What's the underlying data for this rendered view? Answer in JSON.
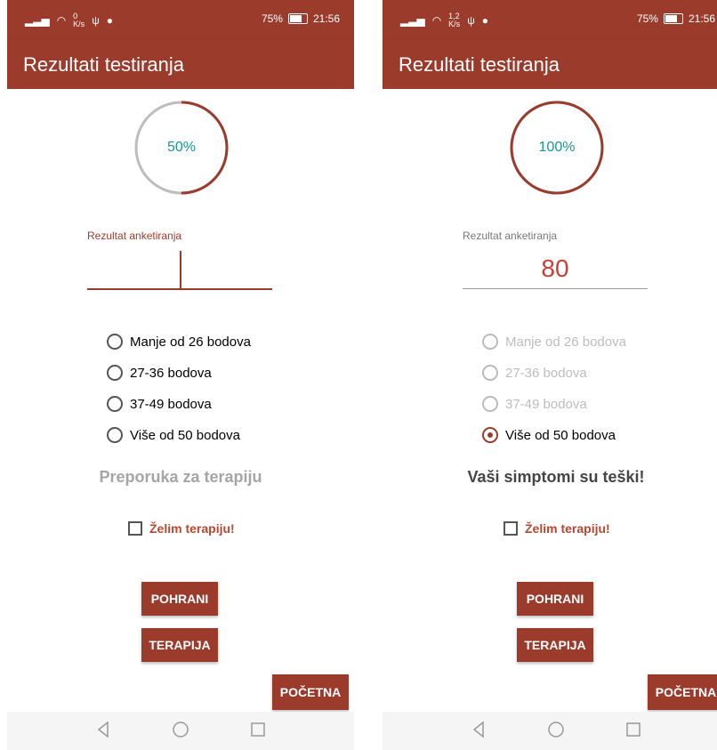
{
  "colors": {
    "accent": "#9b3b2c",
    "teal": "#139a8f",
    "light_grey": "#bdbdbd",
    "value_red": "#c73f36"
  },
  "screens": [
    {
      "status": {
        "speed_top": "0",
        "speed_unit": "K/s",
        "battery": "75%",
        "time": "21:56"
      },
      "appbar_title": "Rezultati testiranja",
      "progress_text": "50%",
      "progress_value": 0.5,
      "field_label": "Rezultat anketiranja",
      "field_value": "",
      "radio_options": [
        {
          "label": "Manje od 26 bodova",
          "checked": false,
          "disabled": false
        },
        {
          "label": "27-36 bodova",
          "checked": false,
          "disabled": false
        },
        {
          "label": "37-49 bodova",
          "checked": false,
          "disabled": false
        },
        {
          "label": "Više od 50 bodova",
          "checked": false,
          "disabled": false
        }
      ],
      "recommendation": "Preporuka za terapiju",
      "checkbox_label": "Želim terapiju!",
      "buttons": {
        "save": "POHRANI",
        "therapy": "TERAPIJA",
        "home": "POČETNA"
      }
    },
    {
      "status": {
        "speed_top": "1,2",
        "speed_unit": "K/s",
        "battery": "75%",
        "time": "21:56"
      },
      "appbar_title": "Rezultati testiranja",
      "progress_text": "100%",
      "progress_value": 1.0,
      "field_label": "Rezultat anketiranja",
      "field_value": "80",
      "radio_options": [
        {
          "label": "Manje od 26 bodova",
          "checked": false,
          "disabled": true
        },
        {
          "label": "27-36 bodova",
          "checked": false,
          "disabled": true
        },
        {
          "label": "37-49 bodova",
          "checked": false,
          "disabled": true
        },
        {
          "label": "Više od 50 bodova",
          "checked": true,
          "disabled": false
        }
      ],
      "recommendation": "Vaši simptomi su teški!",
      "checkbox_label": "Želim terapiju!",
      "buttons": {
        "save": "POHRANI",
        "therapy": "TERAPIJA",
        "home": "POČETNA"
      }
    }
  ]
}
